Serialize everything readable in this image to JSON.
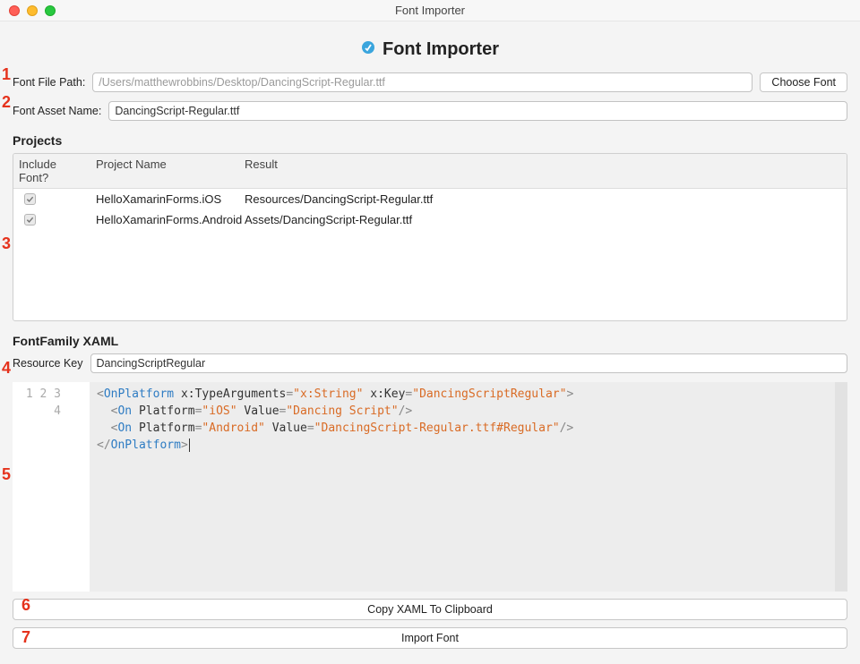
{
  "window": {
    "title": "Font Importer"
  },
  "header": {
    "heading": "Font Importer"
  },
  "fontFilePath": {
    "label": "Font File Path:",
    "value": "/Users/matthewrobbins/Desktop/DancingScript-Regular.ttf",
    "chooseLabel": "Choose Font"
  },
  "fontAssetName": {
    "label": "Font Asset Name:",
    "value": "DancingScript-Regular.ttf"
  },
  "projects": {
    "title": "Projects",
    "columns": {
      "include": "Include Font?",
      "project": "Project Name",
      "result": "Result"
    },
    "rows": [
      {
        "checked": true,
        "project": "HelloXamarinForms.iOS",
        "result": "Resources/DancingScript-Regular.ttf"
      },
      {
        "checked": true,
        "project": "HelloXamarinForms.Android",
        "result": "Assets/DancingScript-Regular.ttf"
      }
    ]
  },
  "xaml": {
    "title": "FontFamily XAML",
    "resourceKeyLabel": "Resource Key",
    "resourceKey": "DancingScriptRegular",
    "lineNumbers": [
      "1",
      "2",
      "3",
      "4"
    ],
    "code": {
      "openTag": "OnPlatform",
      "typeArgsAttr": "x:TypeArguments",
      "typeArgsVal": "x:String",
      "keyAttr": "x:Key",
      "keyVal": "DancingScriptRegular",
      "onTag": "On",
      "platformAttr": "Platform",
      "valueAttr": "Value",
      "rows": [
        {
          "platform": "iOS",
          "value": "Dancing Script"
        },
        {
          "platform": "Android",
          "value": "DancingScript-Regular.ttf#Regular"
        }
      ]
    }
  },
  "buttons": {
    "copy": "Copy XAML To Clipboard",
    "import": "Import Font"
  },
  "callouts": {
    "c1": "1",
    "c2": "2",
    "c3": "3",
    "c4": "4",
    "c5": "5",
    "c6": "6",
    "c7": "7"
  }
}
